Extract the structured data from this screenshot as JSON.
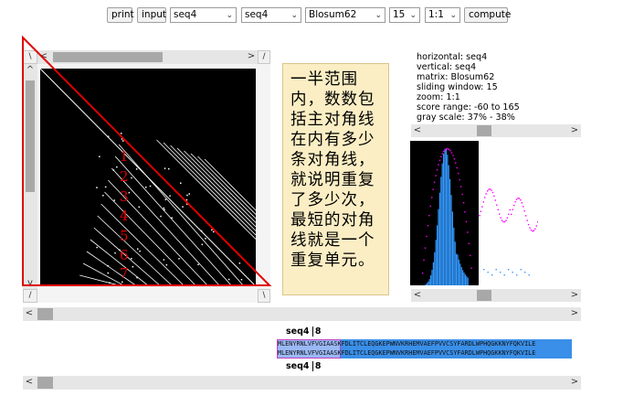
{
  "toolbar": {
    "print_label": "print",
    "input_label": "input",
    "horizontal_seq": "seq4",
    "vertical_seq": "seq4",
    "matrix": "Blosum62",
    "window": "15",
    "zoom": "1:1",
    "compute_label": "compute"
  },
  "corners": {
    "top_left": "\\",
    "top_right": "/",
    "bottom_left": "/",
    "bottom_right": "\\"
  },
  "info": {
    "horizontal": "horizontal: seq4",
    "vertical": "vertical: seq4",
    "matrix": "matrix: Blosum62",
    "window": "sliding window: 15",
    "zoom": "zoom: 1:1",
    "score_range": "score range: -60 to 165",
    "gray_scale": "gray scale: 37% - 38%"
  },
  "annotation": {
    "lines": [
      "一半范围",
      "内，数数包",
      "括主对角线",
      "在内有多少",
      "条对角线，",
      "就说明重复",
      "了多少次，",
      "最短的对角",
      "线就是一个",
      "重复单元。"
    ],
    "numbers": [
      "1",
      "2",
      "3",
      "4",
      "5",
      "6",
      "7"
    ]
  },
  "alignment": {
    "top_label": "seq4",
    "top_pos": "8",
    "bottom_label": "seq4",
    "bottom_pos": "8",
    "highlight": "MLENYRNLVFVGIAA",
    "rest": "SKFDLITCLEQGKEPWNVKRHEMVAEFPVVCSYFARDLWPHQGKKNYFQKVILE"
  },
  "scrollbars": {
    "hscroll_dot": 0.4,
    "vscroll_dot": 0.1,
    "histo_top": 0.1,
    "histo_bottom": 0.1,
    "main_h1": 0.0,
    "main_h2": 0.0
  },
  "colors": {
    "annotation_red": "#e00000",
    "histogram_blue": "#3399ff",
    "curve_magenta": "#ff00ff",
    "note_bg": "#fbeec4",
    "seq_highlight": "#3a8fe8"
  }
}
